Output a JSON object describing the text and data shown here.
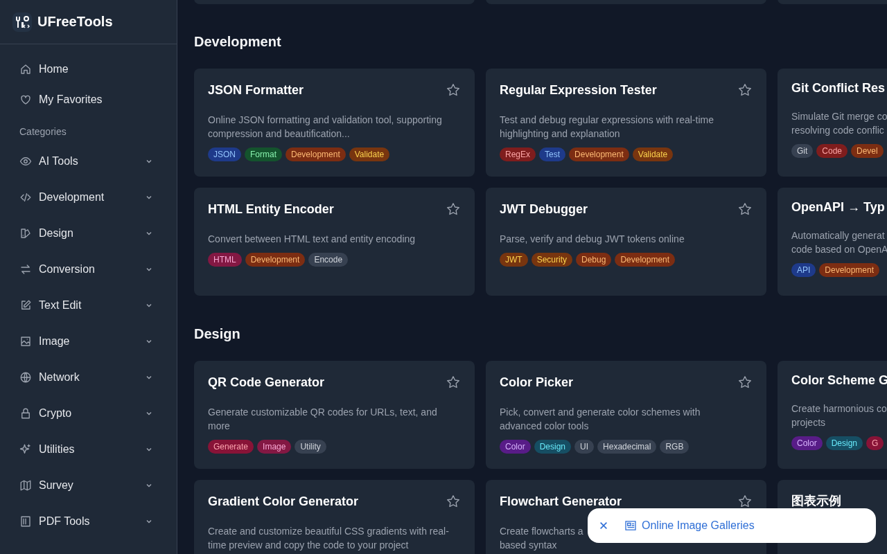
{
  "logo": {
    "name": "UFreeTools"
  },
  "nav": [
    {
      "label": "Home",
      "selected": false
    },
    {
      "label": "My Favorites",
      "selected": false
    }
  ],
  "categories_heading": "Categories",
  "categories": [
    {
      "label": "AI Tools",
      "expanded": false
    },
    {
      "label": "Development",
      "expanded": false
    },
    {
      "label": "Design",
      "expanded": false
    },
    {
      "label": "Conversion",
      "expanded": false
    },
    {
      "label": "Text Edit",
      "expanded": false
    },
    {
      "label": "Image",
      "expanded": false
    },
    {
      "label": "Network",
      "expanded": false
    },
    {
      "label": "Crypto",
      "expanded": false
    },
    {
      "label": "Utilities",
      "expanded": false
    },
    {
      "label": "Survey",
      "expanded": false
    },
    {
      "label": "PDF Tools",
      "expanded": false
    }
  ],
  "sections": [
    {
      "title": "Development",
      "cards": [
        {
          "title": "JSON Formatter",
          "favorite": false,
          "description": [
            "Online JSON formatting and validation tool, supporting",
            "compression and beautification..."
          ],
          "tags": [
            {
              "label": "JSON",
              "color": "#1e3a8a"
            },
            {
              "label": "Format",
              "color": "#14532d"
            },
            {
              "label": "Development",
              "color": "#7c2d12"
            },
            {
              "label": "Validate",
              "color": "#78350f"
            }
          ]
        },
        {
          "title": "Regular Expression Tester",
          "favorite": false,
          "description": [
            "Test and debug regular expressions with real-time",
            "highlighting and explanation"
          ],
          "tags": [
            {
              "label": "RegEx",
              "color": "#7f1d1d"
            },
            {
              "label": "Test",
              "color": "#1e3a8a"
            },
            {
              "label": "Development",
              "color": "#7c2d12"
            },
            {
              "label": "Validate",
              "color": "#78350f"
            }
          ]
        },
        {
          "title": "Git Conflict Res",
          "description": [
            "Simulate Git merge co",
            "resolving code conflic"
          ],
          "tags": [
            {
              "label": "Git",
              "color": "#374151"
            },
            {
              "label": "Code",
              "color": "#7f1d1d"
            },
            {
              "label": "Devel",
              "color": "#7c2d12"
            }
          ]
        },
        {
          "title": "HTML Entity Encoder",
          "favorite": false,
          "description": [
            "Convert between HTML text and entity encoding"
          ],
          "tags": [
            {
              "label": "HTML",
              "color": "#831843"
            },
            {
              "label": "Development",
              "color": "#7c2d12"
            },
            {
              "label": "Encode",
              "color": "#374151"
            }
          ]
        },
        {
          "title": "JWT Debugger",
          "favorite": false,
          "description": [
            "Parse, verify and debug JWT tokens online"
          ],
          "tags": [
            {
              "label": "JWT",
              "color": "#78350f"
            },
            {
              "label": "Security",
              "color": "#78350f"
            },
            {
              "label": "Debug",
              "color": "#7c2d12"
            },
            {
              "label": "Development",
              "color": "#7c2d12"
            }
          ]
        },
        {
          "title": "OpenAPI → Typ",
          "description": [
            "Automatically generat",
            "code based on OpenA"
          ],
          "tags": [
            {
              "label": "API",
              "color": "#1e3a8a"
            },
            {
              "label": "Development",
              "color": "#7c2d12"
            }
          ]
        }
      ]
    },
    {
      "title": "Design",
      "cards": [
        {
          "title": "QR Code Generator",
          "favorite": false,
          "description": [
            "Generate customizable QR codes for URLs, text, and",
            "more"
          ],
          "tags": [
            {
              "label": "Generate",
              "color": "#881337"
            },
            {
              "label": "Image",
              "color": "#831843"
            },
            {
              "label": "Utility",
              "color": "#374151"
            }
          ]
        },
        {
          "title": "Color Picker",
          "favorite": false,
          "description": [
            "Pick, convert and generate color schemes with",
            "advanced color tools"
          ],
          "tags": [
            {
              "label": "Color",
              "color": "#581c87"
            },
            {
              "label": "Design",
              "color": "#164e63"
            },
            {
              "label": "UI",
              "color": "#374151"
            },
            {
              "label": "Hexadecimal",
              "color": "#374151"
            },
            {
              "label": "RGB",
              "color": "#374151"
            }
          ]
        },
        {
          "title": "Color Scheme G",
          "description": [
            "Create harmonious co",
            "projects"
          ],
          "tags": [
            {
              "label": "Color",
              "color": "#581c87"
            },
            {
              "label": "Design",
              "color": "#164e63"
            },
            {
              "label": "G",
              "color": "#881337"
            }
          ]
        },
        {
          "title": "Gradient Color Generator",
          "favorite": false,
          "description": [
            "Create and customize beautiful CSS gradients with real-",
            "time preview and copy the code to your project"
          ]
        },
        {
          "title": "Flowchart Generator",
          "favorite": false,
          "description": [
            "Create flowcharts a",
            "based syntax"
          ]
        },
        {
          "title": "图表示例"
        }
      ]
    }
  ],
  "toast": {
    "link": "Online Image Galleries"
  }
}
